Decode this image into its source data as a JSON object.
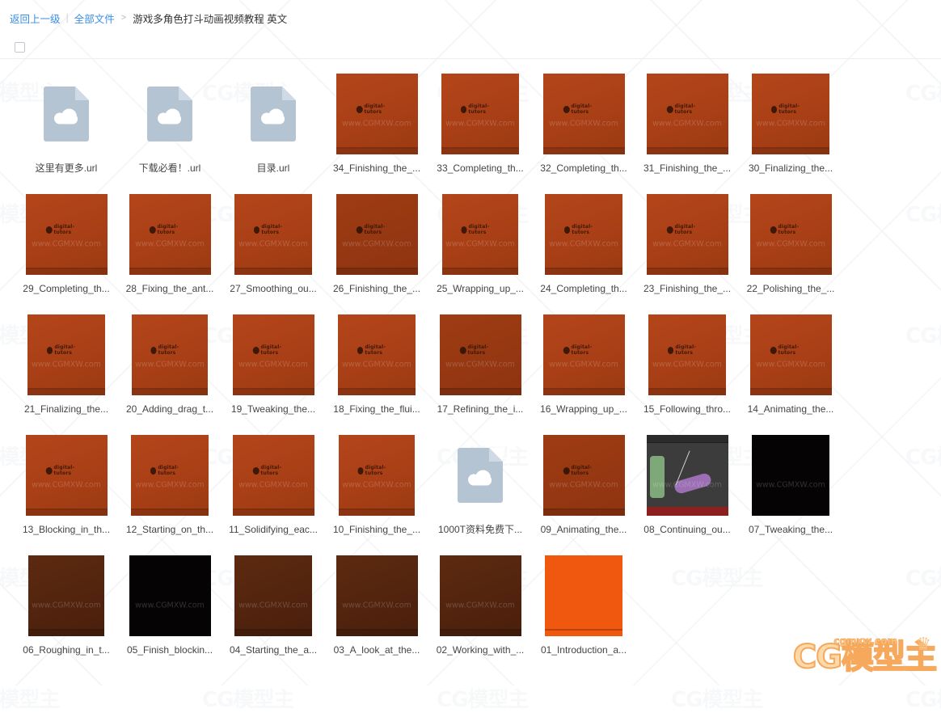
{
  "breadcrumb": {
    "back_label": "返回上一级",
    "separator_bar": "|",
    "root_label": "全部文件",
    "chevron": ">",
    "current_label": "游戏多角色打斗动画视频教程 英文"
  },
  "toolbar": {
    "select_all_checkbox": "select-all"
  },
  "watermark": {
    "page_text": "CG模型主",
    "thumb_text": "www.CGMXW.com",
    "thumb_text_short": "www.CGM",
    "dt_logo_text": "digital-tutors"
  },
  "site_logo": {
    "mark": "CG",
    "name": "模型主",
    "domain": "cgmxw.com",
    "crown": "♛"
  },
  "colors": {
    "link": "#3a8ee6",
    "text": "#444444",
    "thumb_orange": "#b4451a",
    "thumb_orange_dark": "#9e3c14",
    "thumb_orange_bright": "#f0570f",
    "thumb_brown": "#5d2a10",
    "thumb_black": "#050303",
    "file_icon": "#b5c4d3",
    "logo_fill": "#fbd9a8",
    "logo_stroke": "#f6a85c"
  },
  "files": [
    {
      "name": "这里有更多.url",
      "type": "url",
      "thumb": "cloud"
    },
    {
      "name": "下载必看！.url",
      "type": "url",
      "thumb": "cloud"
    },
    {
      "name": "目录.url",
      "type": "url",
      "thumb": "cloud"
    },
    {
      "name": "34_Finishing_the_...",
      "type": "video",
      "thumb": "orange"
    },
    {
      "name": "33_Completing_th...",
      "type": "video",
      "thumb": "orange"
    },
    {
      "name": "32_Completing_th...",
      "type": "video",
      "thumb": "orange"
    },
    {
      "name": "31_Finishing_the_...",
      "type": "video",
      "thumb": "orange"
    },
    {
      "name": "30_Finalizing_the...",
      "type": "video",
      "thumb": "orange"
    },
    {
      "name": "29_Completing_th...",
      "type": "video",
      "thumb": "orange"
    },
    {
      "name": "28_Fixing_the_ant...",
      "type": "video",
      "thumb": "orange"
    },
    {
      "name": "27_Smoothing_ou...",
      "type": "video",
      "thumb": "orange"
    },
    {
      "name": "26_Finishing_the_...",
      "type": "video",
      "thumb": "orange-dark"
    },
    {
      "name": "25_Wrapping_up_...",
      "type": "video",
      "thumb": "orange"
    },
    {
      "name": "24_Completing_th...",
      "type": "video",
      "thumb": "orange"
    },
    {
      "name": "23_Finishing_the_...",
      "type": "video",
      "thumb": "orange"
    },
    {
      "name": "22_Polishing_the_...",
      "type": "video",
      "thumb": "orange"
    },
    {
      "name": "21_Finalizing_the...",
      "type": "video",
      "thumb": "orange"
    },
    {
      "name": "20_Adding_drag_t...",
      "type": "video",
      "thumb": "orange"
    },
    {
      "name": "19_Tweaking_the...",
      "type": "video",
      "thumb": "orange"
    },
    {
      "name": "18_Fixing_the_flui...",
      "type": "video",
      "thumb": "orange"
    },
    {
      "name": "17_Refining_the_i...",
      "type": "video",
      "thumb": "orange-dark"
    },
    {
      "name": "16_Wrapping_up_...",
      "type": "video",
      "thumb": "orange"
    },
    {
      "name": "15_Following_thro...",
      "type": "video",
      "thumb": "orange"
    },
    {
      "name": "14_Animating_the...",
      "type": "video",
      "thumb": "orange"
    },
    {
      "name": "13_Blocking_in_th...",
      "type": "video",
      "thumb": "orange"
    },
    {
      "name": "12_Starting_on_th...",
      "type": "video",
      "thumb": "orange"
    },
    {
      "name": "11_Solidifying_eac...",
      "type": "video",
      "thumb": "orange"
    },
    {
      "name": "10_Finishing_the_...",
      "type": "video",
      "thumb": "orange"
    },
    {
      "name": "1000T资料免费下...",
      "type": "url",
      "thumb": "cloud"
    },
    {
      "name": "09_Animating_the...",
      "type": "video",
      "thumb": "orange-dark"
    },
    {
      "name": "08_Continuing_ou...",
      "type": "video",
      "thumb": "maya"
    },
    {
      "name": "07_Tweaking_the...",
      "type": "video",
      "thumb": "black"
    },
    {
      "name": "06_Roughing_in_t...",
      "type": "video",
      "thumb": "brown"
    },
    {
      "name": "05_Finish_blockin...",
      "type": "video",
      "thumb": "black"
    },
    {
      "name": "04_Starting_the_a...",
      "type": "video",
      "thumb": "brown"
    },
    {
      "name": "03_A_look_at_the...",
      "type": "video",
      "thumb": "brown"
    },
    {
      "name": "02_Working_with_...",
      "type": "video",
      "thumb": "brown"
    },
    {
      "name": "01_Introduction_a...",
      "type": "video",
      "thumb": "bright-orange"
    }
  ]
}
